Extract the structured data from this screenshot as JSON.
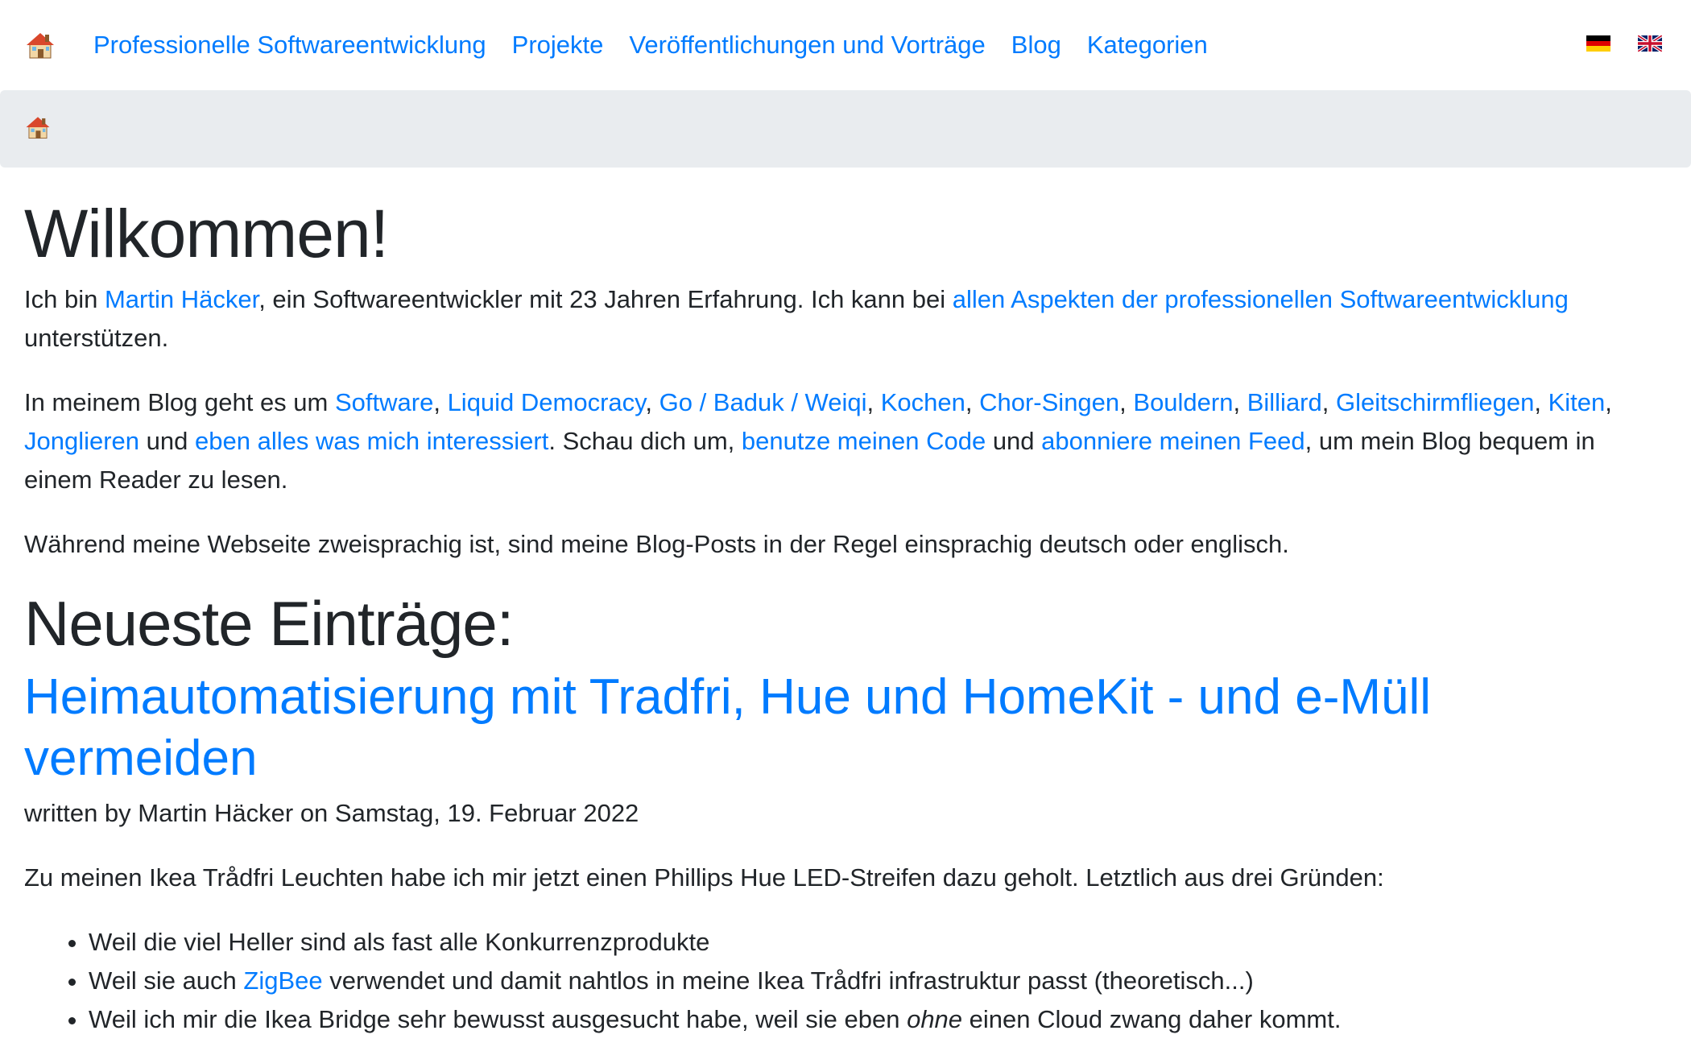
{
  "nav": {
    "home_icon": "house-icon",
    "links": [
      "Professionelle Softwareentwicklung",
      "Projekte",
      "Veröffentlichungen und Vorträge",
      "Blog",
      "Kategorien"
    ],
    "languages": [
      "german-flag-icon",
      "uk-flag-icon"
    ]
  },
  "breadcrumb": {
    "home_icon": "house-icon"
  },
  "welcome": {
    "title": "Wilkommen!",
    "p1": {
      "t1": "Ich bin ",
      "link_name": "Martin Häcker",
      "t2": ", ein Softwareentwickler mit 23 Jahren Erfahrung. Ich kann bei ",
      "link_aspects": "allen Aspekten der professionellen Softwareentwicklung",
      "t3": " unterstützen."
    },
    "p2": {
      "t1": "In meinem Blog geht es um ",
      "topics": [
        "Software",
        "Liquid Democracy",
        "Go / Baduk / Weiqi",
        "Kochen",
        "Chor-Singen",
        "Bouldern",
        "Billiard",
        "Gleitschirmfliegen",
        "Kiten",
        "Jonglieren"
      ],
      "sep": ", ",
      "and1": " und ",
      "link_everything": "eben alles was mich interessiert",
      "t2": ". Schau dich um, ",
      "link_code": "benutze meinen Code",
      "and2": " und ",
      "link_feed": "abonniere meinen Feed",
      "t3": ", um mein Blog bequem in einem Reader zu lesen."
    },
    "p3": "Während meine Webseite zweisprachig ist, sind meine Blog-Posts in der Regel einsprachig deutsch oder englisch."
  },
  "latest": {
    "heading": "Neueste Einträge:",
    "post": {
      "title": "Heimautomatisierung mit Tradfri, Hue und HomeKit - und e-Müll vermeiden",
      "byline": "written by Martin Häcker on Samstag, 19. Februar 2022",
      "intro": "Zu meinen Ikea Trådfri Leuchten habe ich mir jetzt einen Phillips Hue LED-Streifen dazu geholt. Letztlich aus drei Gründen:",
      "bullet1": "Weil die viel Heller sind als fast alle Konkurrenzprodukte",
      "bullet2_a": "Weil sie auch ",
      "bullet2_link": "ZigBee",
      "bullet2_b": " verwendet und damit nahtlos in meine Ikea Trådfri infrastruktur passt (theoretisch...)",
      "bullet3_a": "Weil ich mir die Ikea Bridge sehr bewusst ausgesucht habe, weil sie eben ",
      "bullet3_em": "ohne",
      "bullet3_b": " einen Cloud zwang daher kommt."
    }
  }
}
